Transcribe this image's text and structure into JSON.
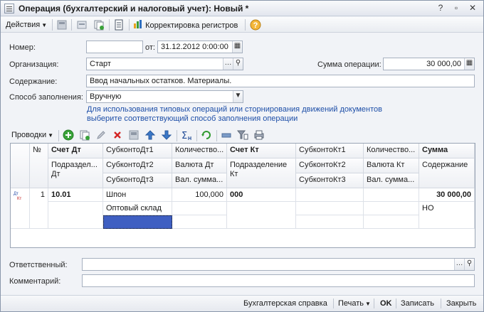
{
  "window": {
    "title": "Операция (бухгалтерский и налоговый учет): Новый *"
  },
  "toolbar": {
    "actions_label": "Действия",
    "register_adjust_label": "Корректировка регистров"
  },
  "form": {
    "number_label": "Номер:",
    "number_value": "",
    "date_from_label": "от:",
    "date_value": "31.12.2012  0:00:00",
    "org_label": "Организация:",
    "org_value": "Старт",
    "sum_label": "Сумма операции:",
    "sum_value": "30 000,00",
    "content_label": "Содержание:",
    "content_value": "Ввод начальных остатков. Материалы.",
    "fill_label": "Способ заполнения:",
    "fill_value": "Вручную",
    "hint_line1": "Для использования типовых операций или сторнирования движений документов",
    "hint_line2": "выберите соответствующий способ заполнения операции"
  },
  "entries_toolbar": {
    "label": "Проводки"
  },
  "grid": {
    "headers": {
      "num": "№",
      "acc_dt": "Счет Дт",
      "sub_dt1": "СубконтоДт1",
      "qty_dt": "Количество...",
      "acc_kt": "Счет Кт",
      "sub_kt1": "СубконтоКт1",
      "qty_kt": "Количество...",
      "sum": "Сумма",
      "div_dt": "Подраздел... Дт",
      "sub_dt2": "СубконтоДт2",
      "cur_dt": "Валюта Дт",
      "div_kt": "Подразделение Кт",
      "sub_kt2": "СубконтоКт2",
      "cur_kt": "Валюта Кт",
      "content": "Содержание",
      "sub_dt3": "СубконтоДт3",
      "valsum_dt": "Вал. сумма...",
      "sub_kt3": "СубконтоКт3",
      "valsum_kt": "Вал. сумма..."
    },
    "row": {
      "num": "1",
      "acc_dt": "10.01",
      "sub_dt1": "Шпон",
      "qty_dt": "100,000",
      "acc_kt": "000",
      "sum": "30 000,00",
      "sub_dt2": "Оптовый склад",
      "content": "НО"
    }
  },
  "footer_fields": {
    "responsible_label": "Ответственный:",
    "responsible_value": "",
    "comment_label": "Комментарий:",
    "comment_value": ""
  },
  "bottom": {
    "report_label": "Бухгалтерская справка",
    "print_label": "Печать",
    "ok_label": "OK",
    "save_label": "Записать",
    "close_label": "Закрыть"
  }
}
